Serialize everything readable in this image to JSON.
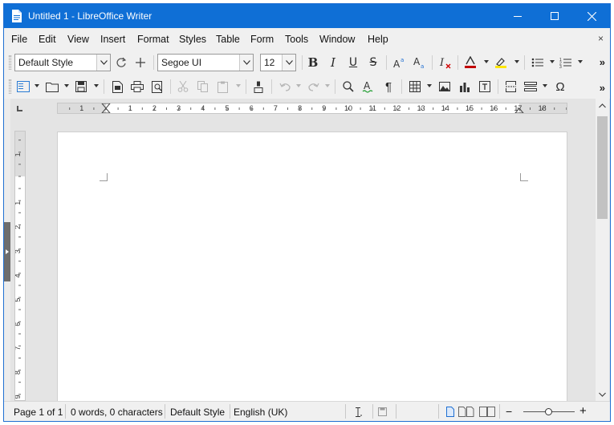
{
  "window": {
    "title": "Untitled 1 - LibreOffice Writer",
    "title_bar_color": "#0f6fd6"
  },
  "menu": {
    "items": [
      "File",
      "Edit",
      "View",
      "Insert",
      "Format",
      "Styles",
      "Table",
      "Form",
      "Tools",
      "Window",
      "Help"
    ],
    "close_label": "×"
  },
  "toolbar": {
    "paragraph_style": "Default Style",
    "font_name": "Segoe UI",
    "font_size": "12",
    "overflow": "»",
    "icons_row1": [
      "update-style-icon",
      "new-style-icon",
      "bold-icon",
      "italic-icon",
      "underline-icon",
      "strikethrough-icon",
      "superscript-icon",
      "subscript-icon",
      "clear-formatting-icon",
      "font-color-icon",
      "highlight-icon",
      "bullet-list-icon",
      "numbered-list-icon"
    ],
    "icons_row2": [
      "sidebar-icon",
      "open-icon",
      "save-icon",
      "export-pdf-icon",
      "print-icon",
      "print-preview-icon",
      "cut-icon",
      "copy-icon",
      "paste-icon",
      "clone-formatting-icon",
      "undo-icon",
      "redo-icon",
      "find-replace-icon",
      "spelling-icon",
      "formatting-marks-icon",
      "insert-table-icon",
      "insert-image-icon",
      "insert-chart-icon",
      "insert-textbox-icon",
      "insert-page-break-icon",
      "insert-field-icon",
      "special-character-icon"
    ],
    "bold": "B",
    "italic": "I",
    "underline": "U",
    "strike": "S",
    "formatting_marks": "¶",
    "special_char": "Ω",
    "font_color": "#c00000",
    "highlight_color": "#ffe600"
  },
  "ruler": {
    "horizontal_labels": [
      "1",
      "1",
      "2",
      "3",
      "4",
      "5",
      "6",
      "7",
      "8",
      "9",
      "10",
      "11",
      "12",
      "13",
      "14",
      "15",
      "16",
      "17",
      "18"
    ],
    "vertical_labels": [
      "1",
      "1",
      "2",
      "3",
      "4",
      "5",
      "6",
      "7",
      "8",
      "9"
    ]
  },
  "status": {
    "page": "Page 1 of 1",
    "words": "0 words, 0 characters",
    "page_style": "Default Style",
    "language": "English (UK)",
    "zoom_minus": "−",
    "zoom_plus": "+"
  }
}
